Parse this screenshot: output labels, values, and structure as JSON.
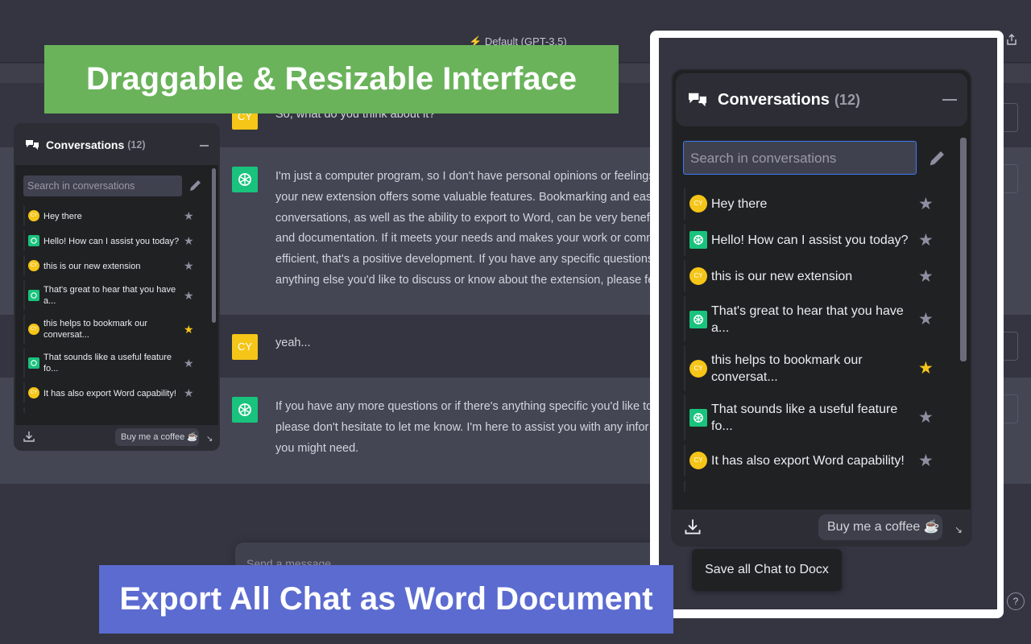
{
  "chatgpt": {
    "model_label": "Default (GPT-3.5)",
    "user_avatar_initials": "CY",
    "messages": [
      {
        "role": "user",
        "lines": [
          "So, what do you think about it?"
        ]
      },
      {
        "role": "assistant",
        "lines": [
          "I'm just a computer program, so I don't have personal opinions or feelings",
          "your new extension offers some valuable features. Bookmarking and eas",
          "conversations, as well as the ability to export to Word, can be very benefi",
          "and documentation. If it meets your needs and makes your work or comm",
          "efficient, that's a positive development. If you have any specific questions",
          "anything else you'd like to discuss or know about the extension, please fe"
        ]
      },
      {
        "role": "user",
        "lines": [
          "yeah..."
        ]
      },
      {
        "role": "assistant",
        "lines": [
          "If you have any more questions or if there's anything specific you'd like to",
          "please don't hesitate to let me know. I'm here to assist you with any infor",
          "you might need."
        ]
      }
    ],
    "composer_placeholder": "Send a message",
    "help_label": "?"
  },
  "banners": {
    "top": "Draggable & Resizable Interface",
    "bottom": "Export All Chat as Word Document"
  },
  "extension": {
    "title": "Conversations",
    "count": "(12)",
    "search_placeholder": "Search in conversations",
    "coffee_label": "Buy me a coffee ☕",
    "tooltip": "Save all Chat to Docx",
    "items": [
      {
        "type": "user",
        "text": "Hey there",
        "starred": false
      },
      {
        "type": "gpt",
        "text": "Hello! How can I assist you today?",
        "starred": false
      },
      {
        "type": "user",
        "text": "this is our new extension",
        "starred": false
      },
      {
        "type": "gpt",
        "text": "That's great to hear that you have a...",
        "starred": false
      },
      {
        "type": "user",
        "text": "this helps to bookmark our conversat...",
        "starred": true
      },
      {
        "type": "gpt",
        "text": "That sounds like a useful feature fo...",
        "starred": false
      },
      {
        "type": "user",
        "text": "It has also export Word capability!",
        "starred": false
      },
      {
        "type": "gpt",
        "text": "",
        "starred": false
      }
    ]
  },
  "colors": {
    "page_bg": "#343541",
    "assistant_row_bg": "#444654",
    "panel_bg": "#202123",
    "user_avatar": "#f5c518",
    "gpt_avatar": "#19c37d",
    "star_active": "#f5c518",
    "banner_green": "#6ab35b",
    "banner_blue": "#5b6bd0",
    "search_focus": "#3d7bf7"
  },
  "icons": {
    "model": "lightning-icon",
    "share": "share-icon",
    "conversations": "chat-bubbles-icon",
    "edit": "pencil-icon",
    "download": "download-icon",
    "star": "star-icon",
    "resize": "resize-icon"
  }
}
